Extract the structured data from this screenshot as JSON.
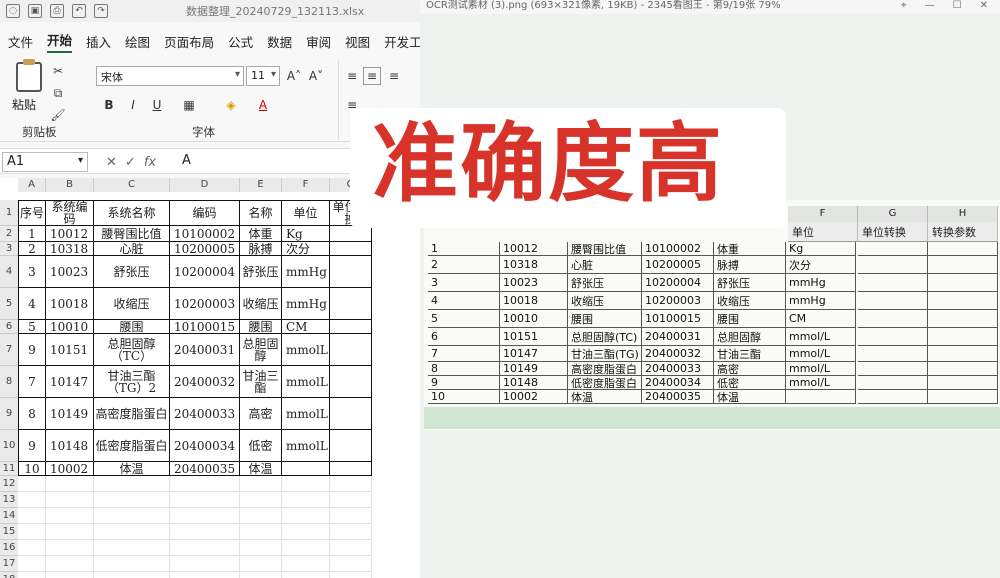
{
  "excel": {
    "title": "数据整理_20240729_132113.xlsx",
    "menu": [
      "文件",
      "开始",
      "插入",
      "绘图",
      "页面布局",
      "公式",
      "数据",
      "审阅",
      "视图",
      "开发工"
    ],
    "active_tab": "开始",
    "clipboard": {
      "paste_label": "粘贴",
      "group_label": "剪贴板"
    },
    "font": {
      "name": "宋体",
      "size": "11",
      "group_label": "字体",
      "bold": "B",
      "italic": "I",
      "underline": "U",
      "grow": "A˄",
      "shrink": "A˅",
      "color": "A"
    },
    "name_box": "A1",
    "formula_value": "A",
    "columns": [
      "A",
      "B",
      "C",
      "D",
      "E",
      "F",
      "G"
    ],
    "headers": [
      "序号",
      "系统编码",
      "系统名称",
      "编码",
      "名称",
      "单位",
      "单位转换"
    ],
    "rows": [
      [
        "1",
        "10012",
        "腰臀围比值",
        "10100002",
        "体重",
        "Kg"
      ],
      [
        "2",
        "10318",
        "心脏",
        "10200005",
        "脉搏",
        "次分"
      ],
      [
        "3",
        "10023",
        "舒张压",
        "10200004",
        "舒张压",
        "mmHg"
      ],
      [
        "4",
        "10018",
        "收缩压",
        "10200003",
        "收缩压",
        "mmHg"
      ],
      [
        "5",
        "10010",
        "腰围",
        "10100015",
        "腰围",
        "CM"
      ],
      [
        "9",
        "10151",
        "总胆固醇（TC）",
        "20400031",
        "总胆固醇",
        "mmolL"
      ],
      [
        "7",
        "10147",
        "甘油三酯（TG）2",
        "20400032",
        "甘油三酯",
        "mmolL"
      ],
      [
        "8",
        "10149",
        "高密度脂蛋白",
        "20400033",
        "高密",
        "mmolL"
      ],
      [
        "9",
        "10148",
        "低密度脂蛋白",
        "20400034",
        "低密",
        "mmolL"
      ],
      [
        "10",
        "10002",
        "体温",
        "20400035",
        "体温",
        ""
      ]
    ],
    "row_numbers": [
      "1",
      "2",
      "3",
      "4",
      "5",
      "6",
      "7",
      "8",
      "9",
      "10",
      "11",
      "12",
      "13",
      "14",
      "15",
      "16",
      "17",
      "18"
    ]
  },
  "viewer": {
    "title": "OCR测试素材 (3).png (693×321像素, 19KB) - 2345看图王 - 第9/19张 79%",
    "photo_columns": [
      "F",
      "G",
      "H"
    ],
    "photo_headers": [
      "单位",
      "单位转换",
      "转换参数"
    ],
    "photo_rows": [
      [
        "1",
        "10012",
        "腰臀围比值",
        "10100002",
        "体重",
        "Kg"
      ],
      [
        "2",
        "10318",
        "心脏",
        "10200005",
        "脉搏",
        "次分"
      ],
      [
        "3",
        "10023",
        "舒张压",
        "10200004",
        "舒张压",
        "mmHg"
      ],
      [
        "4",
        "10018",
        "收缩压",
        "10200003",
        "收缩压",
        "mmHg"
      ],
      [
        "5",
        "10010",
        "腰围",
        "10100015",
        "腰围",
        "CM"
      ],
      [
        "6",
        "10151",
        "总胆固醇(TC)",
        "20400031",
        "总胆固醇",
        "mmol/L"
      ],
      [
        "7",
        "10147",
        "甘油三酯(TG)",
        "20400032",
        "甘油三酯",
        "mmol/L"
      ],
      [
        "8",
        "10149",
        "高密度脂蛋白",
        "20400033",
        "高密",
        "mmol/L"
      ],
      [
        "9",
        "10148",
        "低密度脂蛋白",
        "20400034",
        "低密",
        "mmol/L"
      ],
      [
        "10",
        "10002",
        "体温",
        "20400035",
        "体温",
        ""
      ]
    ]
  },
  "caption": "准确度高",
  "colors": {
    "caption_red": "#d8332a",
    "excel_green": "#1d6b3a",
    "viewer_green": "#cfe6d3"
  }
}
